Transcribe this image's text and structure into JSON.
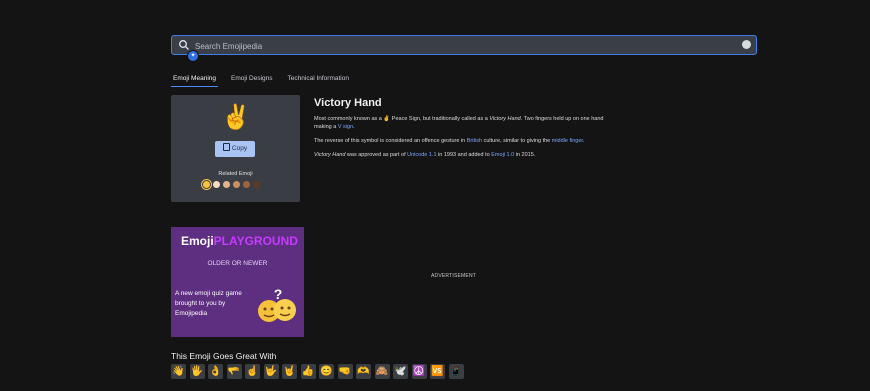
{
  "search": {
    "placeholder": "Search Emojipedia",
    "badge_icon": "pin-icon"
  },
  "tabs": [
    {
      "label": "Emoji Meaning",
      "active": true
    },
    {
      "label": "Emoji Designs",
      "active": false
    },
    {
      "label": "Technical Information",
      "active": false
    }
  ],
  "emoji": {
    "glyph": "✌️",
    "copy_label": "Copy",
    "related_label": "Related Emoji",
    "skin_tones": [
      "#f6c33e",
      "#f7dcc0",
      "#e3b58f",
      "#c98f63",
      "#9c6540",
      "#5d3a26"
    ]
  },
  "article": {
    "title": "Victory Hand",
    "p1_a": "Most commonly known as a ",
    "p1_glyph": "✌️",
    "p1_b": " Peace Sign, but traditionally called as a ",
    "p1_em": "Victory Hand",
    "p1_c": ". Two fingers held up on one hand making a ",
    "p1_link": "V sign",
    "p1_d": ".",
    "p2_a": "The reverse of this symbol is considered an offence gesture in ",
    "p2_link1": "British",
    "p2_b": " culture, similar to giving the ",
    "p2_link2": "middle finger",
    "p2_c": ".",
    "p3_em": "Victory Hand",
    "p3_a": " was approved as part of ",
    "p3_link1": "Unicode 1.1",
    "p3_b": " in 1993 and added to ",
    "p3_link2": "Emoji 1.0",
    "p3_c": " in 2015."
  },
  "playground": {
    "title_a": "Emoji",
    "title_b": "PLAYGROUND",
    "subtitle": "OLDER OR NEWER",
    "text": "A new emoji quiz game brought to you by Emojipedia"
  },
  "advertisement_label": "ADVERTISEMENT",
  "goes_great_with": {
    "title": "This Emoji Goes Great With",
    "items": [
      "👋",
      "🖐️",
      "👌",
      "🫳",
      "☝️",
      "🤟",
      "🤘",
      "👍",
      "😊",
      "🤜",
      "🫶",
      "🙈",
      "🕊️",
      "☮️",
      "🆚",
      "📱"
    ]
  },
  "colors": {
    "accent": "#3f7de8",
    "link": "#7aa7ff",
    "card": "#3a3d44",
    "playground": "#5e2e80"
  }
}
